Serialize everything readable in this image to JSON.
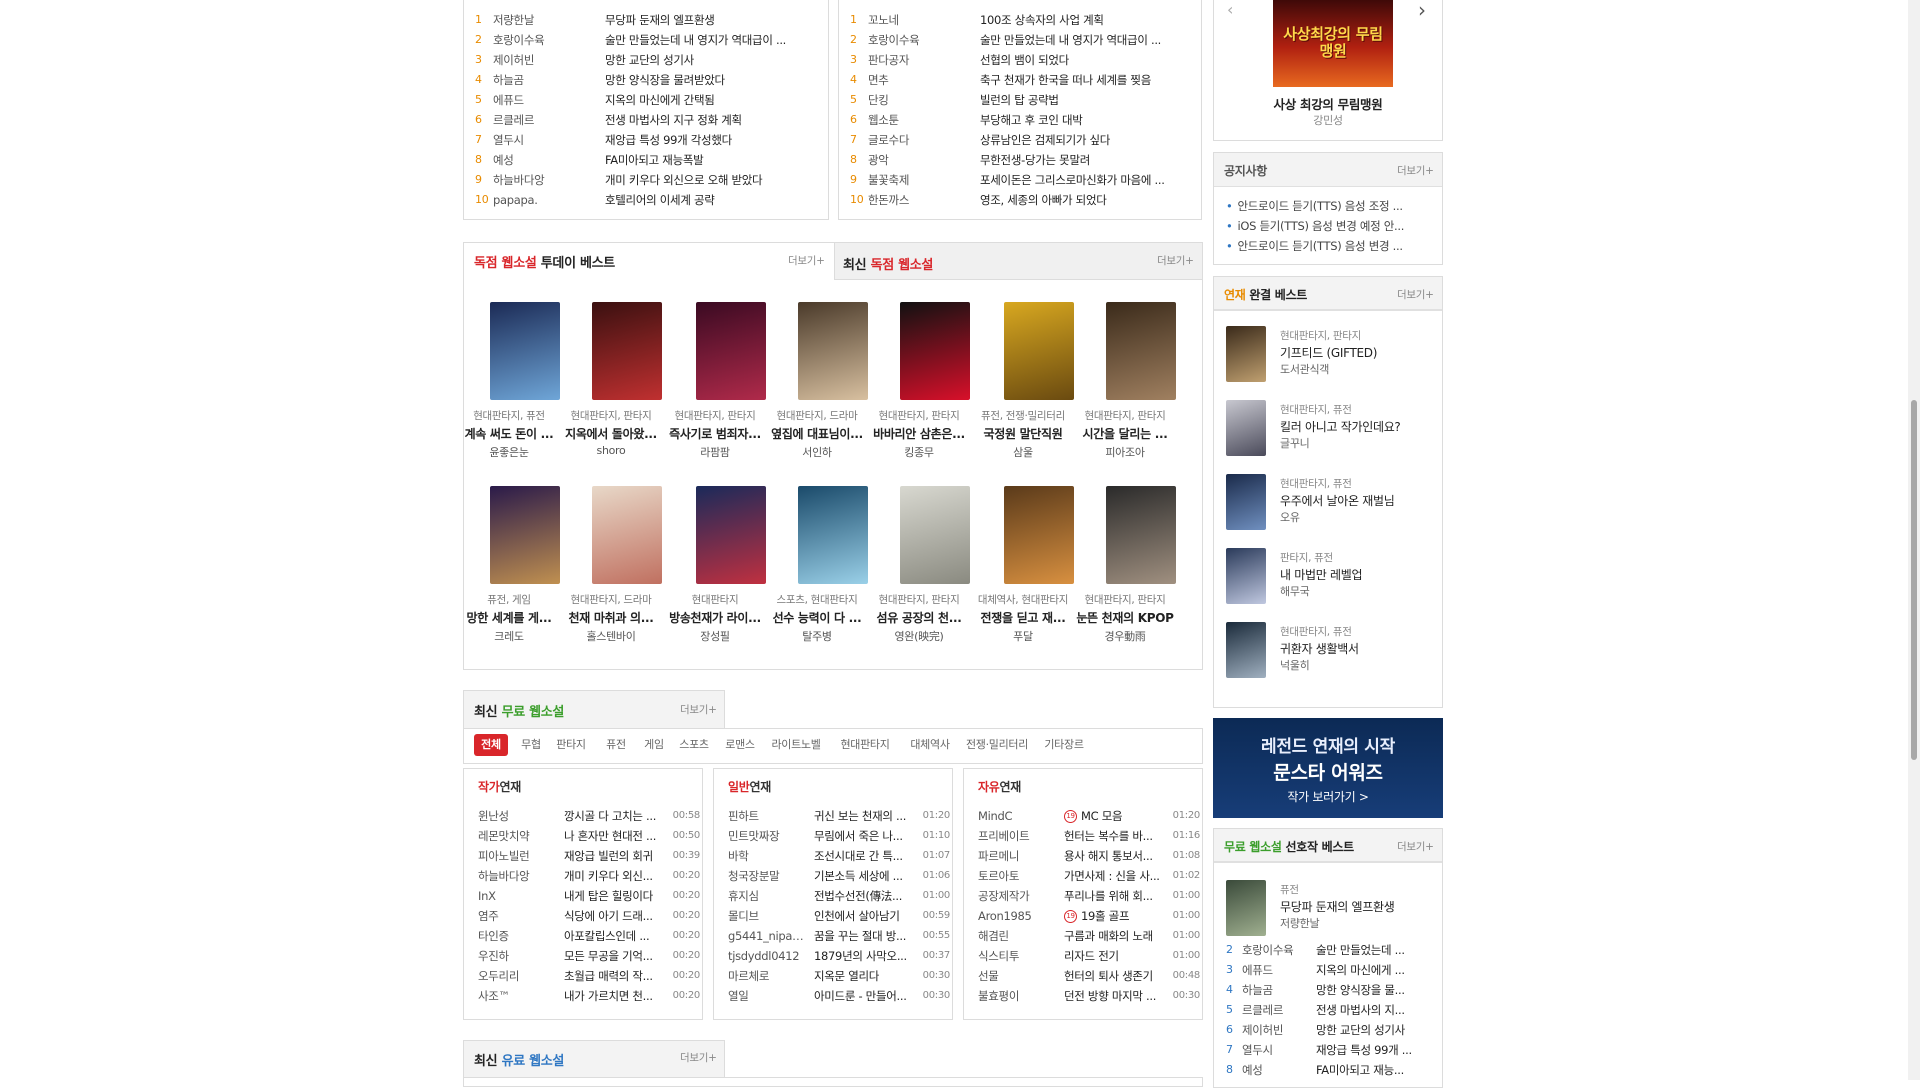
{
  "rank_left": [
    {
      "n": "1",
      "a": "저량한날",
      "t": "무당파 둔재의 엘프환생"
    },
    {
      "n": "2",
      "a": "호랑이수육",
      "t": "술만 만들었는데 내 영지가 역대급이 ..."
    },
    {
      "n": "3",
      "a": "제이허빈",
      "t": "망한 교단의 성기사"
    },
    {
      "n": "4",
      "a": "하늘곰",
      "t": "망한 양식장을 물려받았다"
    },
    {
      "n": "5",
      "a": "에퓨드",
      "t": "지옥의 마신에게 간택됨"
    },
    {
      "n": "6",
      "a": "르클레르",
      "t": "전생 마법사의 지구 정화 계획"
    },
    {
      "n": "7",
      "a": "열두시",
      "t": "재앙급 특성 99개 각성했다"
    },
    {
      "n": "8",
      "a": "예성",
      "t": "FA미아되고 재능폭발"
    },
    {
      "n": "9",
      "a": "하늘바다앙",
      "t": "개미 키우다 외신으로 오해 받았다"
    },
    {
      "n": "10",
      "a": "papapa.",
      "t": "호텔리어의 이세계 공략"
    }
  ],
  "rank_right": [
    {
      "n": "1",
      "a": "꼬노네",
      "t": "100조 상속자의 사업 계획"
    },
    {
      "n": "2",
      "a": "호랑이수육",
      "t": "술만 만들었는데 내 영지가 역대급이 ..."
    },
    {
      "n": "3",
      "a": "판다공자",
      "t": "선협의 뱀이 되었다"
    },
    {
      "n": "4",
      "a": "면추",
      "t": "축구 천재가 한국을 떠나 세계를 찢음"
    },
    {
      "n": "5",
      "a": "단킹",
      "t": "빌런의 탑 공략법"
    },
    {
      "n": "6",
      "a": "웹소툰",
      "t": "부당해고 후 코인 대박"
    },
    {
      "n": "7",
      "a": "글로수다",
      "t": "상류남인은 검제되기가 싶다"
    },
    {
      "n": "8",
      "a": "광악",
      "t": "무한전생-당가는 못말려"
    },
    {
      "n": "9",
      "a": "불꽃축제",
      "t": "포세이돈은 그리스로마신화가 마음에 ..."
    },
    {
      "n": "10",
      "a": "한돈까스",
      "t": "영조, 세종의 아빠가 되었다"
    }
  ],
  "today_best": {
    "tab1_pre": "독점 웹소설",
    "tab1_post": "투데이 베스트",
    "tab2_pre": "최신",
    "tab2_post": "독점 웹소설",
    "more": "더보기+",
    "books": [
      {
        "g": "현대판타지, 퓨전",
        "t": "계속 써도 돈이 ...",
        "a": "윤좋은눈",
        "c1": "#1b2a55",
        "c2": "#6fa6d8"
      },
      {
        "g": "현대판타지, 판타지",
        "t": "지옥에서 돌아왔...",
        "a": "shoro",
        "c1": "#3a1010",
        "c2": "#c03030"
      },
      {
        "g": "현대판타지, 판타지",
        "t": "즉사기로 범죄자...",
        "a": "라팜팜",
        "c1": "#3a0a22",
        "c2": "#b02a4a"
      },
      {
        "g": "현대판타지, 드라마",
        "t": "옆집에 대표님이...",
        "a": "서인하",
        "c1": "#4a3a2a",
        "c2": "#d8c0a0"
      },
      {
        "g": "현대판타지, 판타지",
        "t": "바바리안 삼촌은...",
        "a": "킹종무",
        "c1": "#111111",
        "c2": "#d8102a"
      },
      {
        "g": "퓨전, 전쟁·밀리터리",
        "t": "국정원 말단직원",
        "a": "삼울",
        "c1": "#d8a820",
        "c2": "#6a4a10"
      },
      {
        "g": "현대판타지, 판타지",
        "t": "시간을 달리는 ...",
        "a": "피아조아",
        "c1": "#3a2a1a",
        "c2": "#a08060"
      },
      {
        "g": "퓨전, 게임",
        "t": "망한 세계를 게...",
        "a": "크레도",
        "c1": "#2a1a4a",
        "c2": "#c09050"
      },
      {
        "g": "현대판타지, 드라마",
        "t": "천재 마취과 의...",
        "a": "홀스텐바이",
        "c1": "#e8d8c8",
        "c2": "#c07060"
      },
      {
        "g": "현대판타지",
        "t": "방송천재가 라이...",
        "a": "장성필",
        "c1": "#1a2a5a",
        "c2": "#c03040"
      },
      {
        "g": "스포츠, 현대판타지",
        "t": "선수 능력이 다 ...",
        "a": "탈주병",
        "c1": "#1a4a6a",
        "c2": "#9ad0e8"
      },
      {
        "g": "현대판타지, 판타지",
        "t": "섬유 공장의 천...",
        "a": "영완(映完)",
        "c1": "#d8d8d0",
        "c2": "#8a8a80"
      },
      {
        "g": "대체역사, 현대판타지",
        "t": "전쟁을 딛고 재...",
        "a": "푸달",
        "c1": "#5a3a1a",
        "c2": "#d89040"
      },
      {
        "g": "현대판타지, 판타지",
        "t": "눈뜬 천재의 KPOP",
        "a": "경우動雨",
        "c1": "#2a2a2a",
        "c2": "#a09080"
      }
    ]
  },
  "free_latest": {
    "pre": "최신",
    "hl": "무료 웹소설",
    "more": "더보기+",
    "cats": [
      "전체",
      "무협",
      "판타지",
      "퓨전",
      "게임",
      "스포츠",
      "로맨스",
      "라이트노벨",
      "현대판타지",
      "대체역사",
      "전쟁·밀리터리",
      "기타장르"
    ],
    "cols": [
      {
        "hl": "작가",
        "post": "연재",
        "rows": [
          {
            "a": "윈난성",
            "t": "깡시골 다 고치는 ...",
            "tm": "00:58"
          },
          {
            "a": "레몬맛치약",
            "t": "나 혼자만 현대전 ...",
            "tm": "00:50"
          },
          {
            "a": "피아노빌런",
            "t": "재앙급 빌런의 회귀",
            "tm": "00:39"
          },
          {
            "a": "하늘바다앙",
            "t": "개미 키우다 외신...",
            "tm": "00:20"
          },
          {
            "a": "InX",
            "t": "내게 탑은 힐링이다",
            "tm": "00:20"
          },
          {
            "a": "염주",
            "t": "식당에 아기 드래...",
            "tm": "00:20"
          },
          {
            "a": "타인증",
            "t": "아포칼립스인데 ...",
            "tm": "00:20"
          },
          {
            "a": "우진하",
            "t": "모든 무공을 기억...",
            "tm": "00:20"
          },
          {
            "a": "오두리리",
            "t": "초월급 매력의 작...",
            "tm": "00:20"
          },
          {
            "a": "사조™",
            "t": "내가 가르치면 천...",
            "tm": "00:20"
          }
        ]
      },
      {
        "hl": "일반",
        "post": "연재",
        "rows": [
          {
            "a": "핀하트",
            "t": "귀신 보는 천재의 ...",
            "tm": "01:20"
          },
          {
            "a": "민트맛짜장",
            "t": "무림에서 죽은 나...",
            "tm": "01:10"
          },
          {
            "a": "바학",
            "t": "조선시대로 간 특...",
            "tm": "01:07"
          },
          {
            "a": "청국장분말",
            "t": "기본소득 세상에 ...",
            "tm": "01:06"
          },
          {
            "a": "휴지심",
            "t": "전법수선전(傳法...",
            "tm": "01:00"
          },
          {
            "a": "몰디브",
            "t": "인천에서 살아남기",
            "tm": "00:59"
          },
          {
            "a": "g5441_nipa0...",
            "t": "꿈을 꾸는 절대 방...",
            "tm": "00:55"
          },
          {
            "a": "tjsdyddl0412",
            "t": "1879년의 사막오...",
            "tm": "00:37"
          },
          {
            "a": "마르체로",
            "t": "지옥문 열리다",
            "tm": "00:30"
          },
          {
            "a": "열일",
            "t": "아미드룬 - 만들어...",
            "tm": "00:30"
          }
        ]
      },
      {
        "hl": "자유",
        "post": "연재",
        "rows": [
          {
            "a": "MindC",
            "t": "MC 모음",
            "tm": "01:20",
            "b": "19"
          },
          {
            "a": "프리베이트",
            "t": "헌터는 복수를 바...",
            "tm": "01:16"
          },
          {
            "a": "파르메니",
            "t": "용사 해지 통보서...",
            "tm": "01:08"
          },
          {
            "a": "토르아토",
            "t": "가면사제 : 신을 사...",
            "tm": "01:02"
          },
          {
            "a": "공장제작가",
            "t": "푸리나를 위해 회...",
            "tm": "01:00"
          },
          {
            "a": "Aron1985",
            "t": "19홀 골프",
            "tm": "01:00",
            "b": "19"
          },
          {
            "a": "해겸린",
            "t": "구름과 매화의 노래",
            "tm": "01:00"
          },
          {
            "a": "식스티투",
            "t": "리자드 전기",
            "tm": "01:00"
          },
          {
            "a": "선물",
            "t": "헌터의 퇴사 생존기",
            "tm": "00:48"
          },
          {
            "a": "불효평이",
            "t": "던전 방향 마지막 ...",
            "tm": "00:30"
          }
        ]
      }
    ]
  },
  "paid_latest": {
    "pre": "최신",
    "hl": "유료 웹소설",
    "more": "더보기+"
  },
  "sidebar": {
    "feature_title": "사상 최강의 무림맹원",
    "feature_author": "강민성",
    "cover_text": "사상최강의 무림맹원",
    "notice_title": "공지사항",
    "notice_more": "더보기+",
    "notices": [
      "안드로이드 듣기(TTS) 음성 조정 ...",
      "iOS 듣기(TTS) 음성 변경 예정 안...",
      "안드로이드 듣기(TTS) 음성 변경 ..."
    ],
    "complete_pre": "연재",
    "complete_post": "완결 베스트",
    "complete_more": "더보기+",
    "complete": [
      {
        "g": "현대판타지, 판타지",
        "t": "기프티드 (GIFTED)",
        "a": "도서관식객",
        "c1": "#3a2a1a",
        "c2": "#c0a070"
      },
      {
        "g": "현대판타지, 퓨전",
        "t": "킬러 아니고 작가인데요?",
        "a": "글꾸니",
        "c1": "#c8c8d0",
        "c2": "#4a4a5a"
      },
      {
        "g": "현대판타지, 퓨전",
        "t": "우주에서 날아온 재벌님",
        "a": "오유",
        "c1": "#1a2a4a",
        "c2": "#7090c0"
      },
      {
        "g": "판타지, 퓨전",
        "t": "내 마법만 레벨업",
        "a": "해무국",
        "c1": "#2a3a5a",
        "c2": "#c0c8e0"
      },
      {
        "g": "현대판타지, 퓨전",
        "t": "귀환자 생활백서",
        "a": "넉울히",
        "c1": "#1a2a3a",
        "c2": "#a0b0c0"
      }
    ],
    "banner_line1": "레전드 연재의 시작",
    "banner_line2": "문스타 어워즈",
    "banner_btn": "작가 보러가기 >",
    "pick_pre": "무료 웹소설",
    "pick_post": "선호작 베스트",
    "pick_more": "더보기+",
    "pick_first": {
      "g": "퓨전",
      "t": "무당파 둔재의 엘프환생",
      "a": "저량한날"
    },
    "picks": [
      {
        "n": "2",
        "a": "호랑이수육",
        "t": "술만 만들었는데 ..."
      },
      {
        "n": "3",
        "a": "에퓨드",
        "t": "지옥의 마신에게 ..."
      },
      {
        "n": "4",
        "a": "하늘곰",
        "t": "망한 양식장을 물..."
      },
      {
        "n": "5",
        "a": "르클레르",
        "t": "전생 마법사의 지..."
      },
      {
        "n": "6",
        "a": "제이허빈",
        "t": "망한 교단의 성기사"
      },
      {
        "n": "7",
        "a": "열두시",
        "t": "재앙급 특성 99개 ..."
      },
      {
        "n": "8",
        "a": "예성",
        "t": "FA미아되고 재능..."
      }
    ]
  }
}
